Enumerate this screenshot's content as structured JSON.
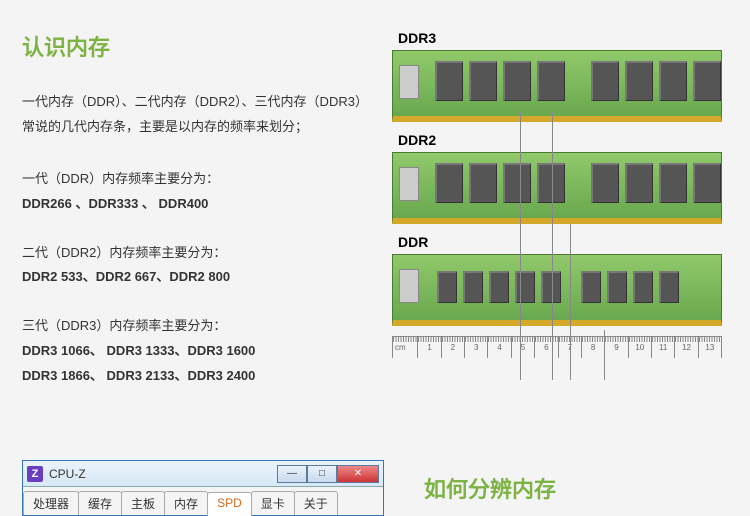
{
  "title": "认识内存",
  "intro": {
    "line1": "一代内存（DDR）、二代内存（DDR2）、三代内存（DDR3）",
    "line2": "常说的几代内存条，主要是以内存的频率来划分；"
  },
  "gen1": {
    "intro": "一代（DDR）内存频率主要分为：",
    "values": "DDR266 、DDR333 、 DDR400"
  },
  "gen2": {
    "intro": "二代（DDR2）内存频率主要分为：",
    "values": "DDR2 533、DDR2 667、DDR2 800"
  },
  "gen3": {
    "intro": "三代（DDR3）内存频率主要分为：",
    "values1": "DDR3 1066、 DDR3 1333、DDR3 1600",
    "values2": "DDR3 1866、 DDR3 2133、DDR3 2400"
  },
  "ram_labels": {
    "ddr3": "DDR3",
    "ddr2": "DDR2",
    "ddr": "DDR"
  },
  "ruler": {
    "unit": "cm",
    "ticks": [
      "1",
      "2",
      "3",
      "4",
      "5",
      "6",
      "7",
      "8",
      "9",
      "10",
      "11",
      "12",
      "13"
    ]
  },
  "cpuz": {
    "title": "CPU-Z",
    "icon_letter": "Z",
    "tabs": [
      "处理器",
      "缓存",
      "主板",
      "内存",
      "SPD",
      "显卡",
      "关于"
    ],
    "active_tab_index": 4
  },
  "title2": "如何分辨内存",
  "icons": {
    "minimize": "—",
    "maximize": "□",
    "close": "✕"
  }
}
